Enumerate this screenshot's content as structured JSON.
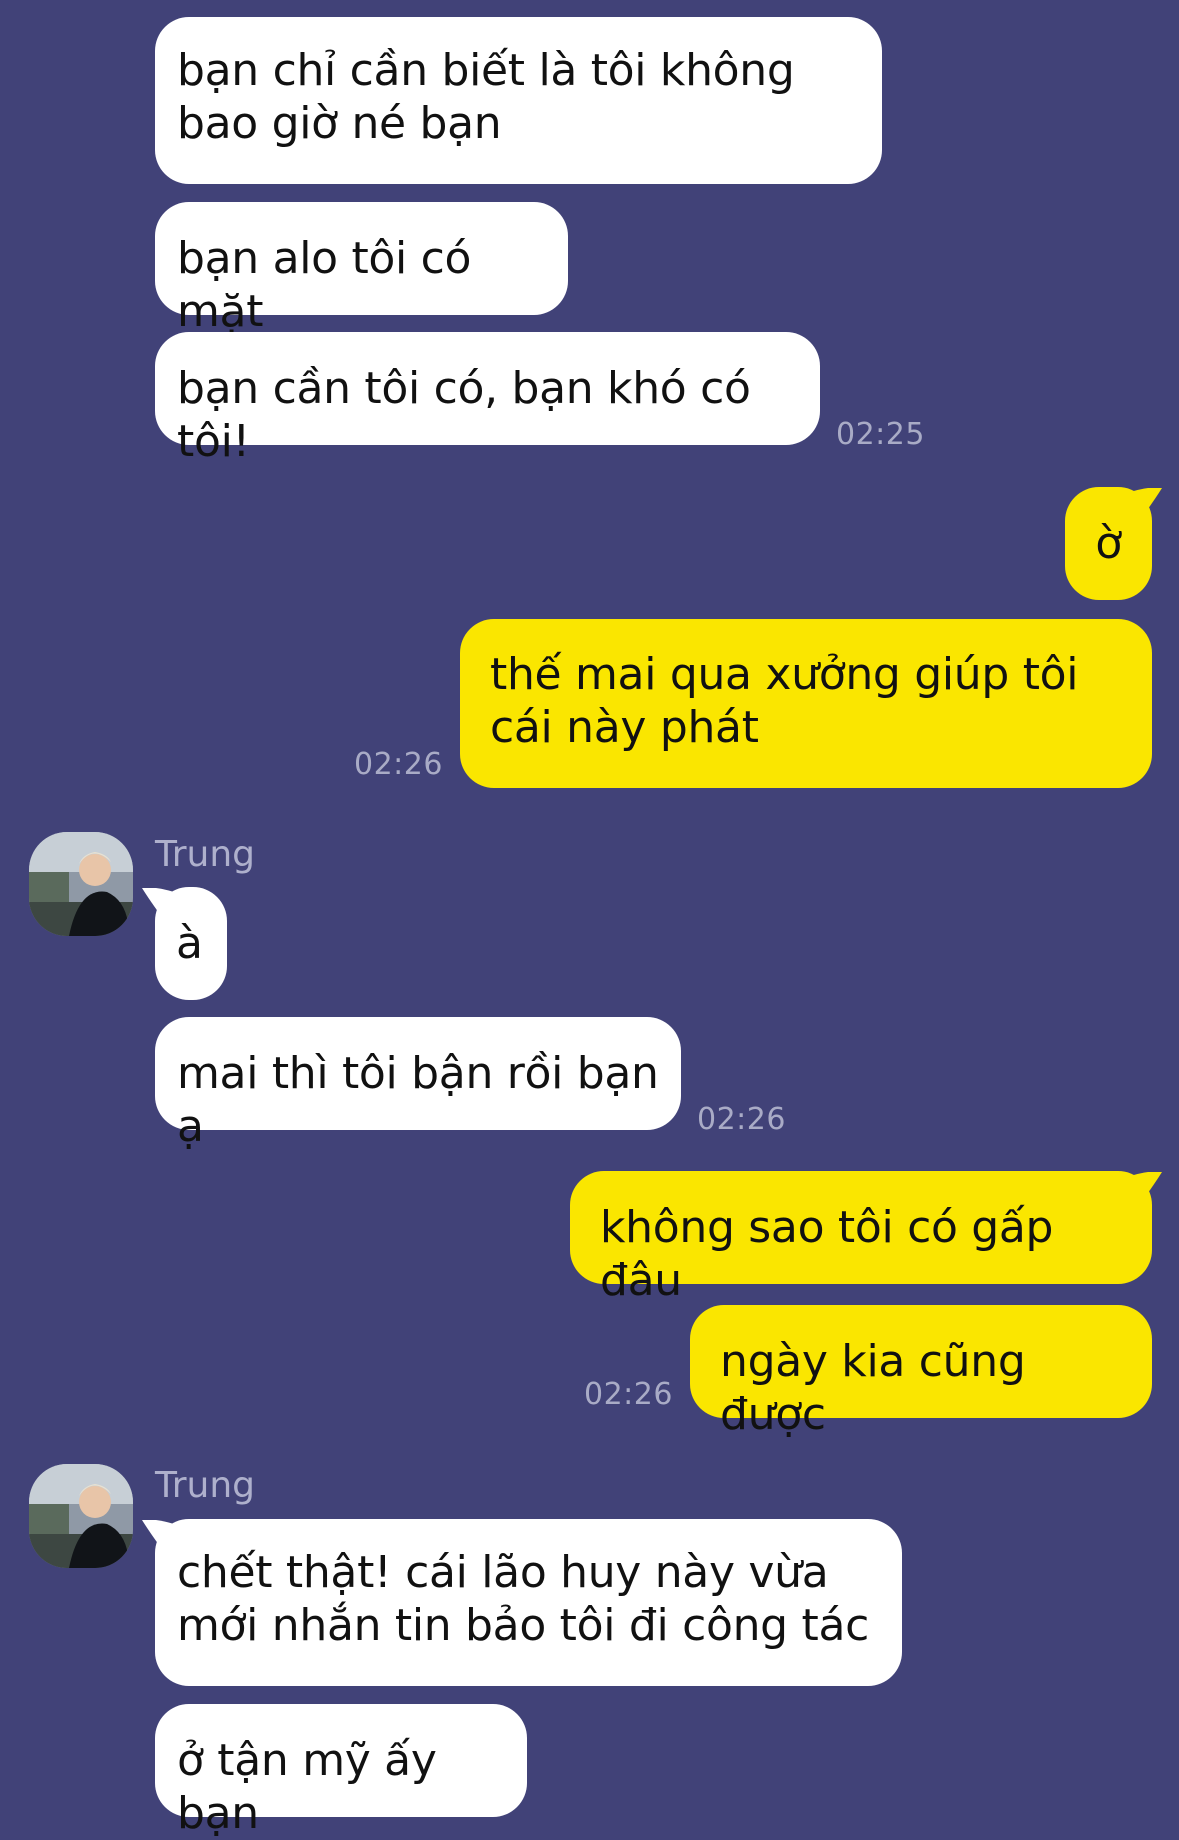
{
  "messages": [
    {
      "text": "bạn chỉ cần biết là tôi không bao giờ né bạn"
    },
    {
      "text": "bạn alo tôi có mặt"
    },
    {
      "text": "bạn cần tôi có, bạn khó có tôi!",
      "time": "02:25"
    },
    {
      "text": "ờ"
    },
    {
      "text": "thế mai qua xưởng giúp tôi cái này phát",
      "time": "02:26"
    },
    {
      "sender": "Trung",
      "text": "à"
    },
    {
      "text": "mai thì tôi bận rồi bạn ạ",
      "time": "02:26"
    },
    {
      "text": "không sao tôi có gấp đâu"
    },
    {
      "text": "ngày kia cũng được",
      "time": "02:26"
    },
    {
      "sender": "Trung",
      "text": "chết thật! cái lão huy này vừa mới nhắn tin bảo tôi đi công tác"
    },
    {
      "text": "ở tận mỹ ấy bạn"
    }
  ],
  "colors": {
    "background": "#414278",
    "incoming_bubble": "#ffffff",
    "outgoing_bubble": "#fae600",
    "timestamp": "#a9abc6"
  },
  "icons": [
    "avatar"
  ]
}
